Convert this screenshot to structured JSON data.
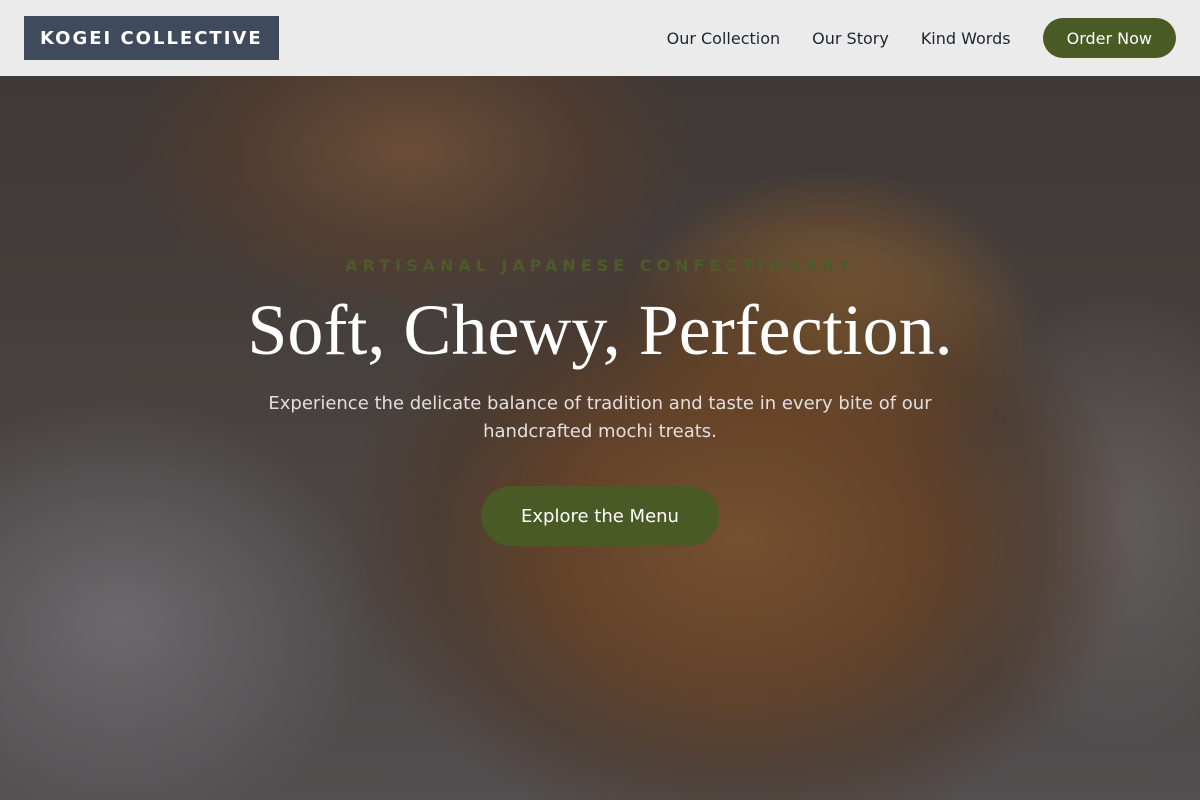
{
  "navbar": {
    "brand": "KOGEI COLLECTIVE",
    "links": [
      {
        "label": "Our Collection"
      },
      {
        "label": "Our Story"
      },
      {
        "label": "Kind Words"
      }
    ],
    "order_button": "Order Now"
  },
  "hero": {
    "eyebrow": "ARTISANAL JAPANESE CONFECTIONERY",
    "headline": "Soft, Chewy, Perfection.",
    "subtext": "Experience the delicate balance of tradition and taste in every bite of our handcrafted mochi treats.",
    "cta_button": "Explore the Menu",
    "background_image": "pastry-photo"
  },
  "colors": {
    "brand_bg": "#3f4a5c",
    "accent_green": "#4a5a25",
    "eyebrow_green": "#4e5a2a",
    "navbar_bg": "#f2f2f2"
  }
}
